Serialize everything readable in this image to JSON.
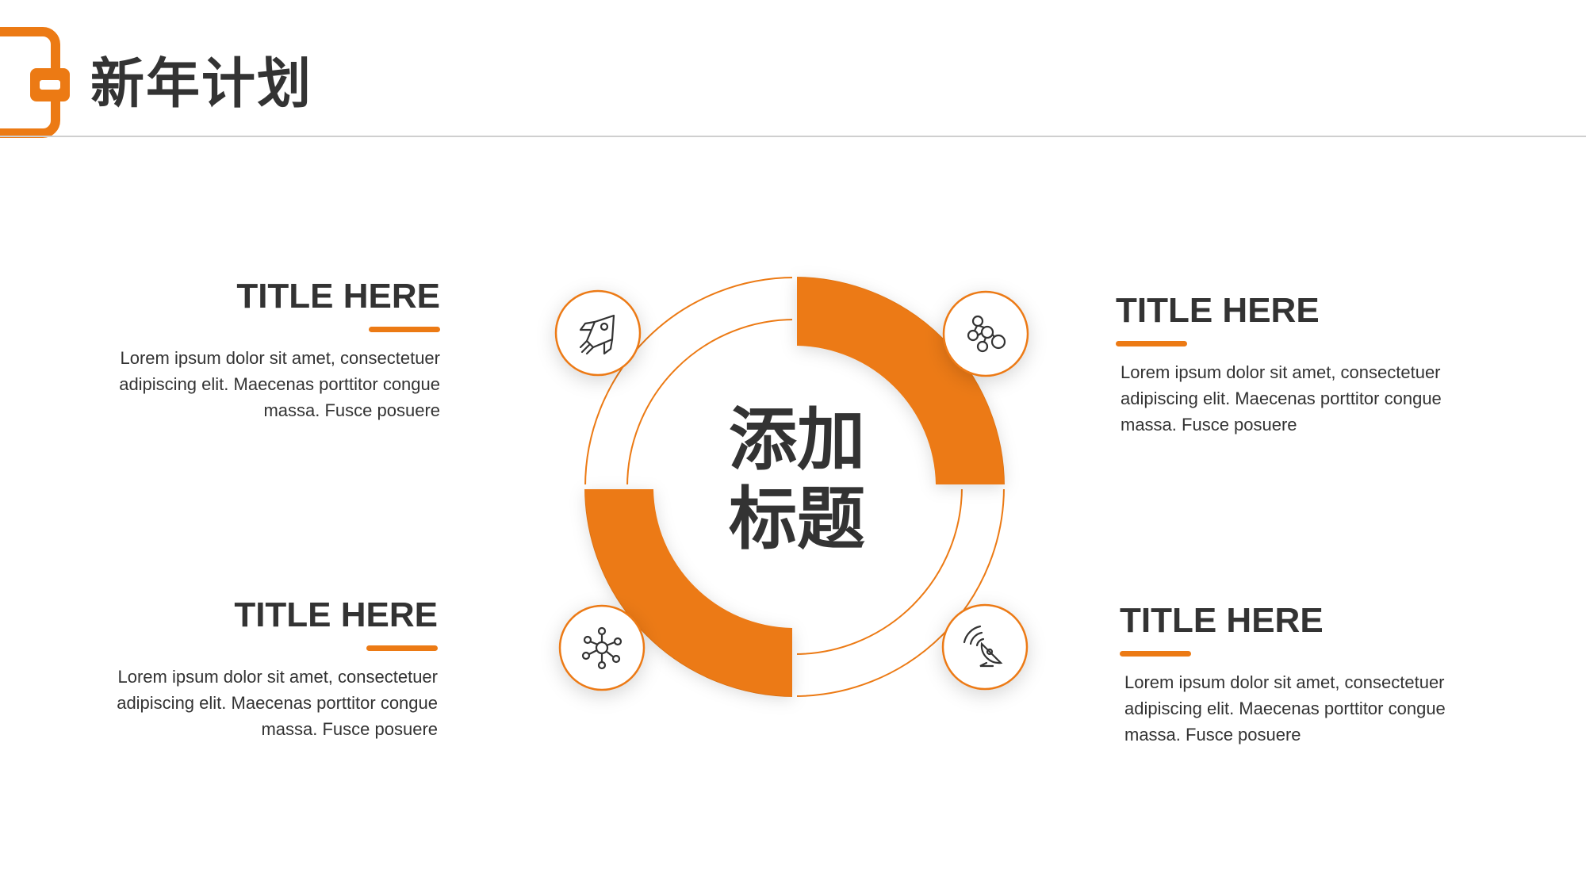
{
  "header": {
    "title": "新年计划"
  },
  "center": {
    "line1": "添加",
    "line2": "标题"
  },
  "blocks": [
    {
      "title": "TITLE HERE",
      "text": "Lorem ipsum dolor sit amet, consectetuer adipiscing elit. Maecenas porttitor congue massa. Fusce posuere",
      "icon": "rocket-icon"
    },
    {
      "title": "TITLE HERE",
      "text": "Lorem ipsum dolor sit amet, consectetuer adipiscing elit. Maecenas porttitor congue massa. Fusce posuere",
      "icon": "molecule-icon"
    },
    {
      "title": "TITLE HERE",
      "text": "Lorem ipsum dolor sit amet, consectetuer adipiscing elit. Maecenas porttitor congue massa. Fusce posuere",
      "icon": "network-icon"
    },
    {
      "title": "TITLE HERE",
      "text": "Lorem ipsum dolor sit amet, consectetuer adipiscing elit. Maecenas porttitor congue massa. Fusce posuere",
      "icon": "satellite-dish-icon"
    }
  ],
  "colors": {
    "accent": "#ec7a14",
    "text": "#333333",
    "rule": "#cfcfcf"
  }
}
